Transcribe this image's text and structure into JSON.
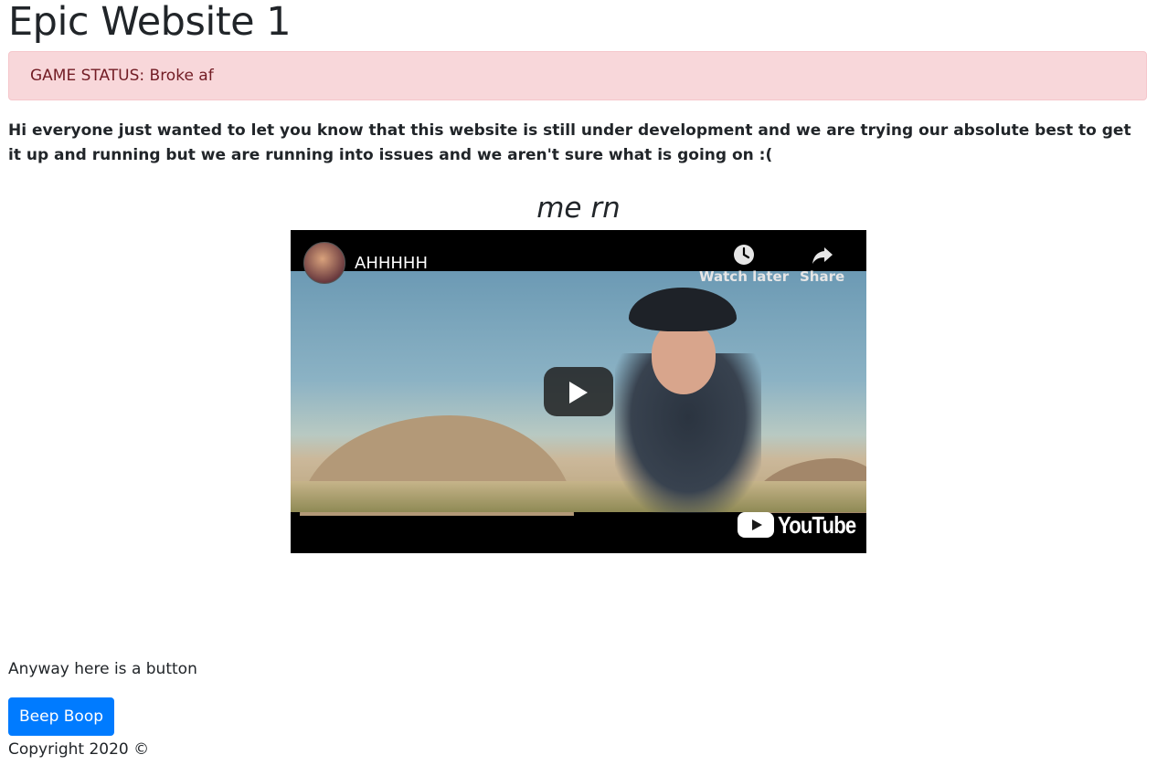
{
  "header": {
    "title": "Epic Website 1"
  },
  "alert": {
    "text": "GAME STATUS: Broke af"
  },
  "intro": {
    "text": "Hi everyone just wanted to let you know that this website is still under development and we are trying our absolute best to get it up and running but we are running into issues and we aren't sure what is going on :("
  },
  "caption": {
    "text": "me rn"
  },
  "video": {
    "title": "AHHHHH",
    "watch_later_label": "Watch later",
    "share_label": "Share",
    "logo_text": "YouTube",
    "icons": [
      "channel-avatar",
      "clock-icon",
      "share-arrow-icon",
      "play-icon",
      "youtube-logo-icon"
    ]
  },
  "body_text": {
    "text": "Anyway here is a button"
  },
  "button": {
    "label": "Beep Boop",
    "color": "#007bff"
  },
  "footer": {
    "text": "Copyright 2020 ©"
  }
}
